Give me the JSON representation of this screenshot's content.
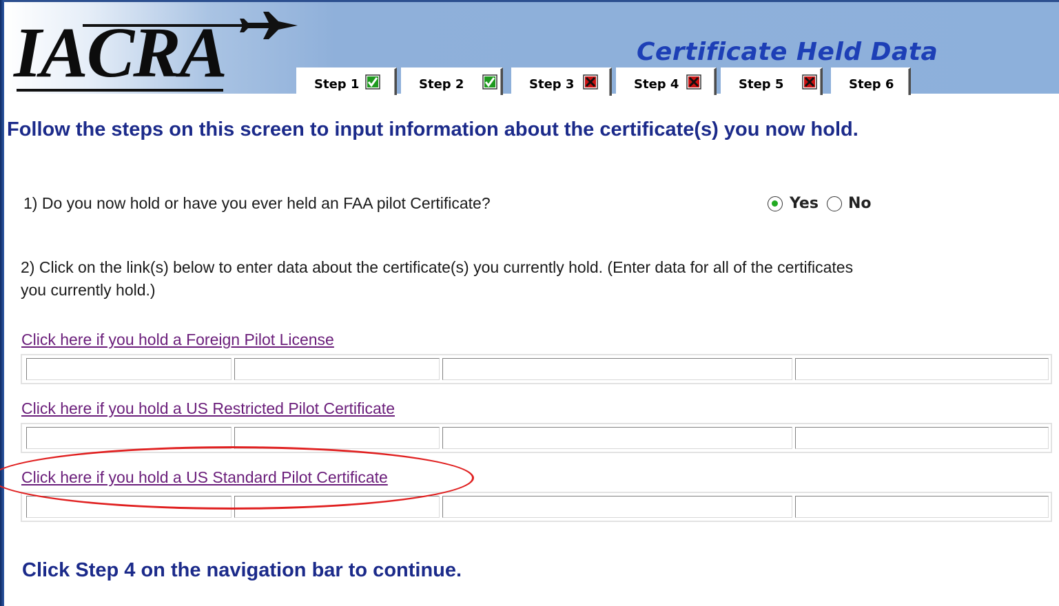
{
  "header": {
    "logo_text": "IACRA",
    "page_heading": "Certificate Held Data",
    "tabs": [
      {
        "label": "Step 1",
        "status": "complete",
        "status_icon": "green-check-icon"
      },
      {
        "label": "Step 2",
        "status": "complete",
        "status_icon": "green-check-icon"
      },
      {
        "label": "Step 3",
        "status": "incomplete",
        "status_icon": "red-x-icon"
      },
      {
        "label": "Step 4",
        "status": "incomplete",
        "status_icon": "red-x-icon"
      },
      {
        "label": "Step 5",
        "status": "incomplete",
        "status_icon": "red-x-icon"
      },
      {
        "label": "Step 6",
        "status": "none"
      }
    ],
    "active_tab": "Step 3"
  },
  "main": {
    "instructions": "Follow the steps on this screen to input information about the certificate(s) you now hold.",
    "question1": {
      "text": "1) Do you now hold or have you ever held an FAA pilot Certificate?",
      "options": [
        "Yes",
        "No"
      ],
      "selected": "Yes"
    },
    "question2": {
      "text": "2) Click on the link(s) below to enter data about the certificate(s) you currently hold.   (Enter data for all of the certificates you currently hold.)"
    },
    "certificates": [
      {
        "link_text": "Click here if you hold a Foreign Pilot License",
        "highlighted": false
      },
      {
        "link_text": "Click here if you hold a US Restricted Pilot Certificate",
        "highlighted": false
      },
      {
        "link_text": "Click here if you hold a US Standard Pilot Certificate",
        "highlighted": true
      }
    ],
    "continue_text": "Click Step 4 on the navigation bar to continue."
  },
  "colors": {
    "header_blue": "#8db0db",
    "heading_blue": "#1d3fb6",
    "text_navy": "#1b2a8a",
    "link_purple": "#6a1d7a",
    "highlight_red": "#e02020",
    "check_green": "#22aa22"
  }
}
